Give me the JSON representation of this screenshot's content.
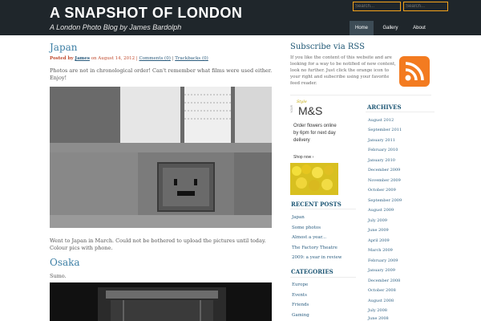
{
  "header": {
    "site_title": "A SNAPSHOT OF LONDON",
    "tagline": "A London Photo Blog by James Bardolph",
    "search_placeholder": "Search...",
    "search2_placeholder": "Search...",
    "nav": [
      "Home",
      "Gallery",
      "About"
    ],
    "accent": "#f6a31b"
  },
  "posts": [
    {
      "title": "Japan",
      "meta": {
        "posted_by": "Posted by",
        "author": "James",
        "date_text": "on August 14, 2012 |",
        "comments": "Comments (0)",
        "separator": "|",
        "trackbacks": "Trackbacks (0)"
      },
      "intro": "Photos are not in chronological order! Can't remember what films were used either. Enjoy!",
      "body": "Went to Japan in March. Could not be bothered to upload the pictures until today. Colour pics with phone."
    },
    {
      "title": "Osaka",
      "intro": "Sumo."
    }
  ],
  "sidebar": {
    "rss_title": "Subscribe via RSS",
    "rss_text": "If you like the content of this website and are looking for a way to be notified of new content, look no further. Just click the orange icon to your right and subscribe using your favorite feed reader.",
    "ad": {
      "brand": "M&S",
      "your": "YOUR",
      "script": "Style",
      "text": "Order flowers online by 6pm for next day delivery",
      "cta": "Shop now ›"
    },
    "recent_posts_title": "RECENT POSTS",
    "recent_posts": [
      "Japan",
      "Some photos",
      "Almost a year...",
      "The Factory Theatre",
      "2009: a year in review"
    ],
    "categories_title": "CATEGORIES",
    "categories": [
      "Europe",
      "Events",
      "Friends",
      "Gaming"
    ],
    "archives_title": "ARCHIVES",
    "archives": [
      "August 2012",
      "September 2011",
      "January 2011",
      "February 2010",
      "January 2010",
      "December 2009",
      "November 2009",
      "October 2009",
      "September 2009",
      "August 2009",
      "July 2009",
      "June 2009",
      "April 2009",
      "March 2009",
      "February 2009",
      "January 2009",
      "December 2008",
      "October 2008",
      "August 2008",
      "July 2008",
      "June 2008"
    ]
  }
}
